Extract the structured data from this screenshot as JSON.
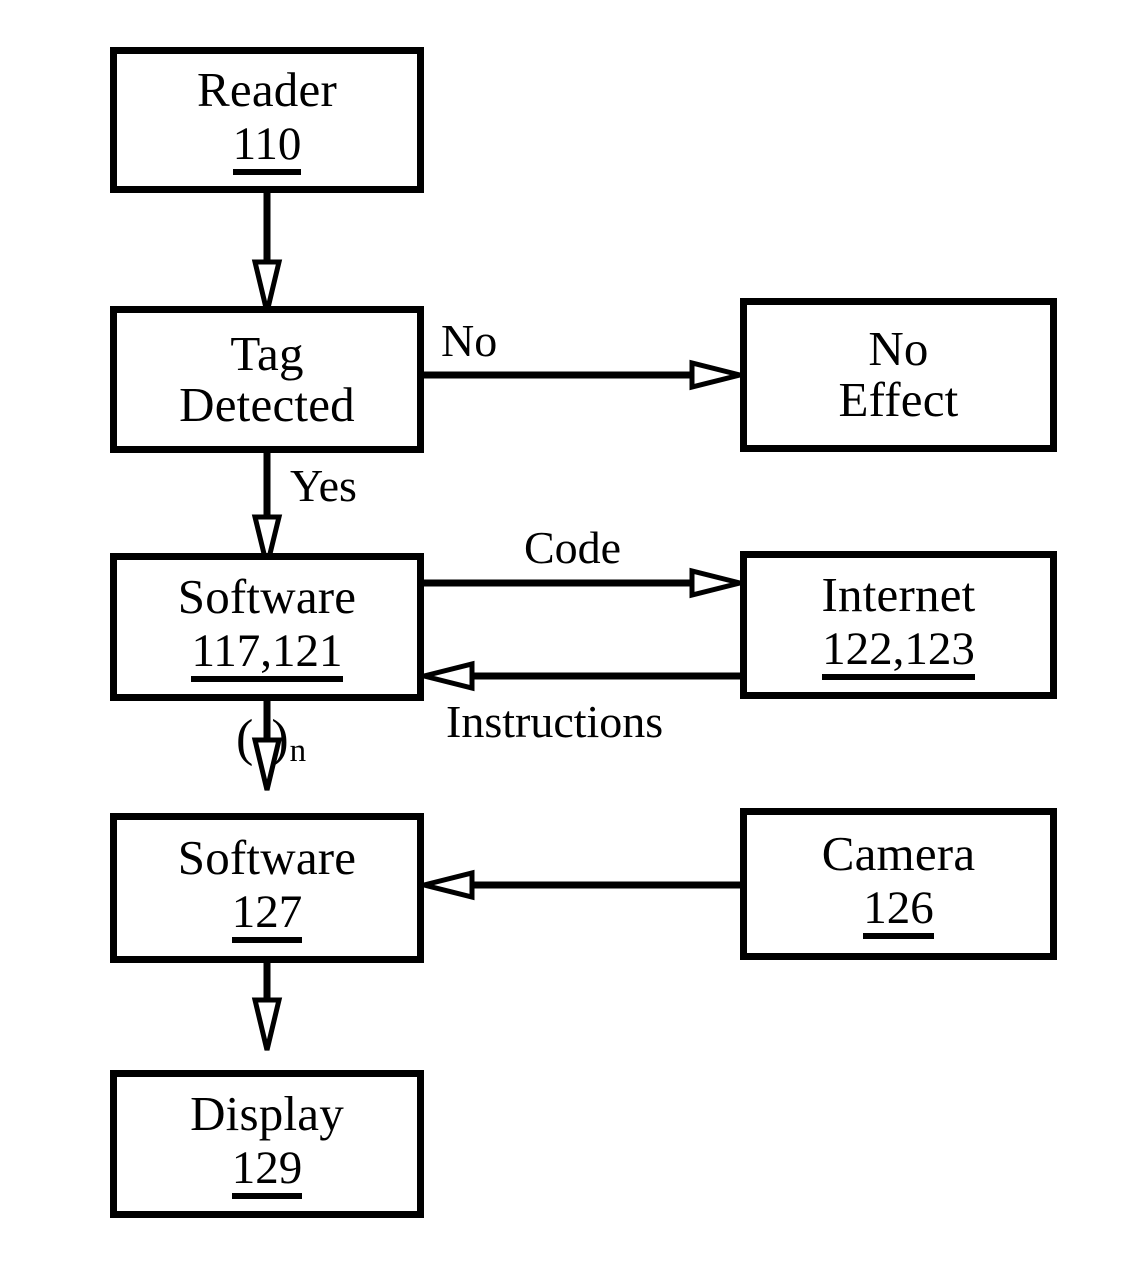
{
  "figure": {
    "type": "flowchart",
    "style": "patent-line-drawing",
    "colors": {
      "stroke": "#000000",
      "background": "#ffffff",
      "arrowhead_fill": "#ffffff"
    }
  },
  "nodes": [
    {
      "id": "reader",
      "title": "Reader",
      "ref": "110",
      "column": "left"
    },
    {
      "id": "tag",
      "title_line1": "Tag",
      "title_line2": "Detected",
      "ref": "",
      "column": "left"
    },
    {
      "id": "software1",
      "title": "Software",
      "ref": "117,121",
      "column": "left"
    },
    {
      "id": "software2",
      "title": "Software",
      "ref": "127",
      "column": "left"
    },
    {
      "id": "display",
      "title": "Display",
      "ref": "129",
      "column": "left"
    },
    {
      "id": "noeffect",
      "title_line1": "No",
      "title_line2": "Effect",
      "ref": "",
      "column": "right"
    },
    {
      "id": "internet",
      "title": "Internet",
      "ref": "122,123",
      "column": "right"
    },
    {
      "id": "camera",
      "title": "Camera",
      "ref": "126",
      "column": "right"
    }
  ],
  "edges": [
    {
      "id": "reader-to-tag",
      "from": "reader",
      "to": "tag",
      "label": "",
      "direction": "down"
    },
    {
      "id": "tag-to-noeffect",
      "from": "tag",
      "to": "noeffect",
      "label": "No",
      "direction": "right"
    },
    {
      "id": "tag-to-software1",
      "from": "tag",
      "to": "software1",
      "label": "Yes",
      "direction": "down"
    },
    {
      "id": "software1-to-internet",
      "from": "software1",
      "to": "internet",
      "label": "Code",
      "direction": "right"
    },
    {
      "id": "internet-to-software1",
      "from": "internet",
      "to": "software1",
      "label": "Instructions",
      "direction": "left"
    },
    {
      "id": "software1-to-software2",
      "from": "software1",
      "to": "software2",
      "label": "( )n",
      "direction": "down"
    },
    {
      "id": "camera-to-software2",
      "from": "camera",
      "to": "software2",
      "label": "",
      "direction": "left"
    },
    {
      "id": "software2-to-display",
      "from": "software2",
      "to": "display",
      "label": "",
      "direction": "down"
    }
  ],
  "labels": {
    "no": "No",
    "yes": "Yes",
    "code": "Code",
    "instructions": "Instructions",
    "loop_open": "(",
    "loop_close": ")",
    "loop_subscript": "n"
  }
}
